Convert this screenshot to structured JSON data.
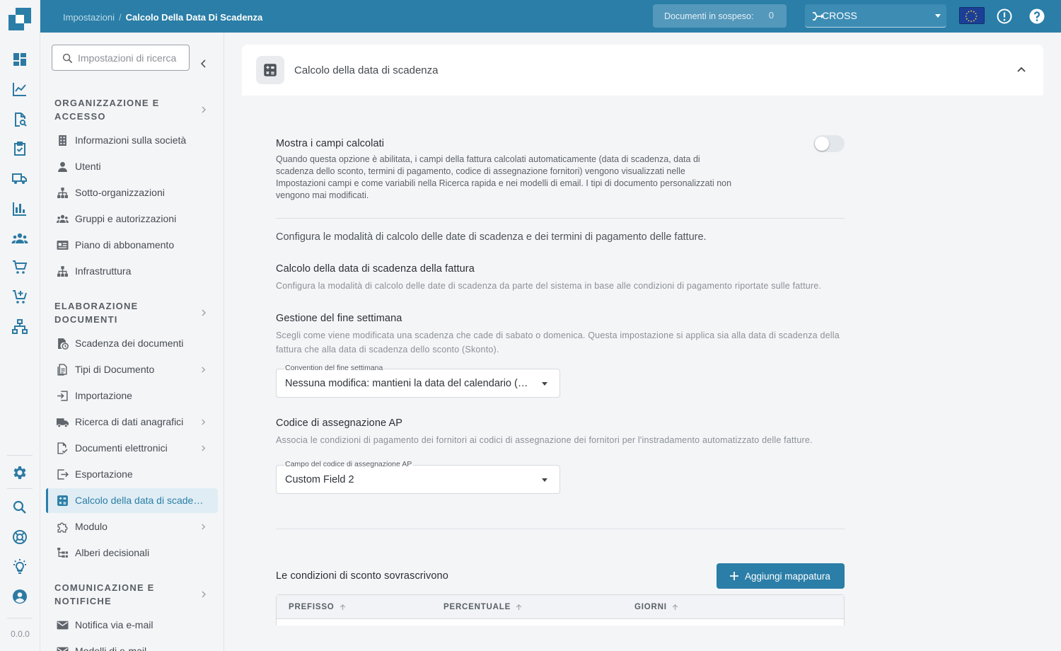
{
  "app": {
    "version": "0.0.0"
  },
  "topbar": {
    "breadcrumb": {
      "parent": "Impostazioni",
      "separator": "/",
      "current": "Calcolo Della Data Di Scadenza"
    },
    "pending": {
      "label": "Documenti in sospeso:",
      "count": "0"
    },
    "org_selector": {
      "value": "CROSS"
    },
    "region_flag": "eu-flag-icon",
    "icons": [
      "alert-icon",
      "help-icon"
    ]
  },
  "rail": {
    "icons": [
      "dashboard-icon",
      "analytics-icon",
      "document-search-icon",
      "task-icon",
      "delivery-icon",
      "bar-chart-icon",
      "people-icon",
      "cart-icon",
      "cart-add-icon",
      "network-icon",
      "settings-icon",
      "search-icon",
      "support-icon",
      "idea-icon",
      "account-icon"
    ]
  },
  "sidebar": {
    "search_placeholder": "Impostazioni di ricerca",
    "sections": [
      {
        "title": "Organizzazione e accesso",
        "items": [
          {
            "label": "Informazioni sulla società",
            "icon": "building-icon"
          },
          {
            "label": "Utenti",
            "icon": "person-icon"
          },
          {
            "label": "Sotto-organizzazioni",
            "icon": "hierarchy-icon"
          },
          {
            "label": "Gruppi e autorizzazioni",
            "icon": "group-icon"
          },
          {
            "label": "Piano di abbonamento",
            "icon": "card-icon"
          },
          {
            "label": "Infrastruttura",
            "icon": "hierarchy-icon"
          }
        ]
      },
      {
        "title": "Elaborazione documenti",
        "items": [
          {
            "label": "Scadenza dei documenti",
            "icon": "document-clock-icon"
          },
          {
            "label": "Tipi di Documento",
            "icon": "documents-icon"
          },
          {
            "label": "Importazione",
            "icon": "import-icon"
          },
          {
            "label": "Ricerca di dati anagrafici",
            "icon": "truck-icon"
          },
          {
            "label": "Documenti elettronici",
            "icon": "edocument-icon"
          },
          {
            "label": "Esportazione",
            "icon": "export-icon"
          },
          {
            "label": "Calcolo della data di scadenza",
            "icon": "calculator-icon"
          },
          {
            "label": "Modulo",
            "icon": "puzzle-icon"
          },
          {
            "label": "Alberi decisionali",
            "icon": "tree-icon"
          }
        ]
      },
      {
        "title": "Comunicazione e notifiche",
        "items": [
          {
            "label": "Notifica via e-mail",
            "icon": "mail-icon"
          },
          {
            "label": "Modelli di e-mail",
            "icon": "mail-icon"
          }
        ]
      }
    ]
  },
  "main": {
    "card_title": "Calcolo della data di scadenza",
    "show_calculated": {
      "title": "Mostra i campi calcolati",
      "description": "Quando questa opzione è abilitata, i campi della fattura calcolati automaticamente (data di scadenza, data di scadenza dello sconto, termini di pagamento, codice di assegnazione fornitori) vengono visualizzati nelle Impostazioni campi e come variabili nella Ricerca rapida e nei modelli di email. I tipi di documento personalizzati non vengono mai modificati.",
      "enabled": false
    },
    "intro": "Configura le modalità di calcolo delle date di scadenza e dei termini di pagamento delle fatture.",
    "invoice_due": {
      "title": "Calcolo della data di scadenza della fattura",
      "description": "Configura la modalità di calcolo delle date di scadenza da parte del sistema in base alle condizioni di pagamento riportate sulle fatture."
    },
    "weekend": {
      "title": "Gestione del fine settimana",
      "description": "Scegli come viene modificata una scadenza che cade di sabato o domenica. Questa impostazione si applica sia alla data di scadenza della fattura che alla data di scadenza dello sconto (Skonto).",
      "select_label": "Convention del fine settimana",
      "select_value": "Nessuna modifica: mantieni la data del calendario (nessun adeguamento)"
    },
    "ap_code": {
      "title": "Codice di assegnazione AP",
      "description": "Associa le condizioni di pagamento dei fornitori ai codici di assegnazione dei fornitori per l'instradamento automatizzato delle fatture.",
      "select_label": "Campo del codice di assegnazione AP",
      "select_value": "Custom Field 2"
    },
    "discount": {
      "title": "Le condizioni di sconto sovrascrivono",
      "add_button": "Aggiungi mappatura",
      "columns": [
        "PREFISSO",
        "PERCENTUALE",
        "GIORNI"
      ]
    }
  }
}
